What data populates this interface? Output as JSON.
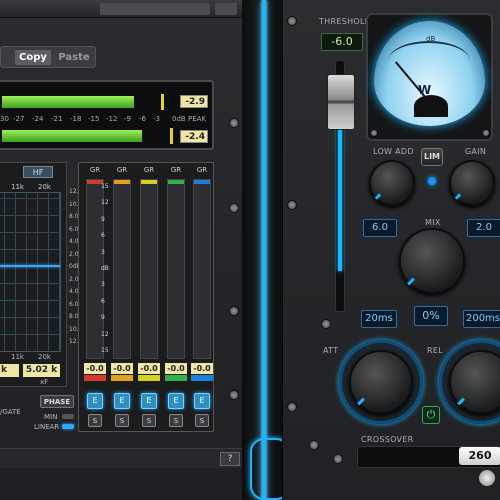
{
  "left_plugin": {
    "copy_label": "Copy",
    "paste_label": "Paste",
    "meter_readouts": [
      "-2.9",
      "-2.4"
    ],
    "meter_scale": [
      "30",
      "-27",
      "-24",
      "-21",
      "-18",
      "-15",
      "-12",
      "-9",
      "-6",
      "-3",
      "0dB",
      "PEAK"
    ],
    "eq": {
      "hf_label": "HF",
      "top_freqs": [
        "11k",
        "20k"
      ],
      "bottom_freqs": [
        "11k",
        "20k"
      ],
      "db_scale": [
        "12.0",
        "10.0",
        "8.0",
        "6.0",
        "4.0",
        "2.0",
        "0dB",
        "2.0",
        "4.0",
        "6.0",
        "8.0",
        "10.0",
        "12.0"
      ],
      "field_left": "k",
      "field_value": "5.02 k",
      "xf_label": "xF"
    },
    "gr": {
      "headers": [
        "GR",
        "GR",
        "GR",
        "GR",
        "GR"
      ],
      "scale": [
        "15",
        "12",
        "9",
        "6",
        "3",
        "dB",
        "3",
        "6",
        "9",
        "12",
        "15"
      ],
      "readouts": [
        "-0.0",
        "-0.0",
        "-0.0",
        "-0.0",
        "-0.0"
      ],
      "band_colors": [
        "#d33a2c",
        "#e0a020",
        "#d8d020",
        "#2fb34a",
        "#1e7fd8"
      ],
      "e_label": "E",
      "s_label": "S"
    },
    "phase_label": "PHASE",
    "min_label": "MIN",
    "linear_label": "LINEAR",
    "gate_label": "/GATE",
    "help_label": "?"
  },
  "right_plugin": {
    "threshold_label": "THRESHOLD",
    "threshold_value": "-6.0",
    "vu_label": "dB",
    "vu_logo": "W",
    "low_add_label": "LOW ADD",
    "lim_label": "LIM",
    "gain_label": "GAIN",
    "low_add_value": "6.0",
    "gain_value": "2.0",
    "mix_label": "MIX",
    "mix_value": "0%",
    "att_value": "20ms",
    "rel_value": "200ms",
    "att_label": "ATT",
    "rel_label": "REL",
    "crossover_label": "CROSSOVER",
    "crossover_value": "260"
  }
}
